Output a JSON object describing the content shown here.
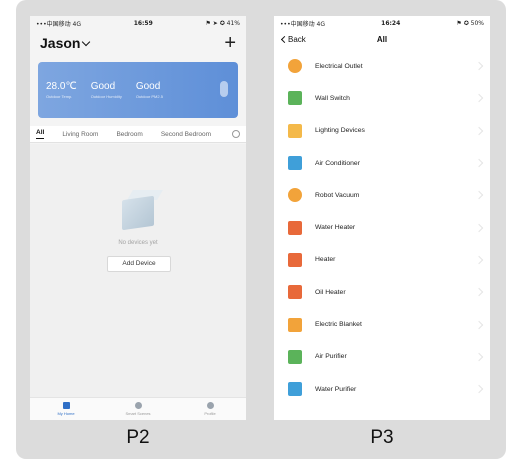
{
  "p2": {
    "status": {
      "carrier": "•••中国移动 4G",
      "time": "16:59",
      "battery": "⚑ ➤ ✪ 41%"
    },
    "header": {
      "home_name": "Jason"
    },
    "weather": {
      "temp": "28.0℃",
      "air": "Good",
      "quality": "Good",
      "temp_sub": "Outdoor Temp.",
      "air_sub": "Outdoor Humidity",
      "quality_sub": "Outdoor PM2.5"
    },
    "tabs": [
      "All",
      "Living Room",
      "Bedroom",
      "Second Bedroom"
    ],
    "empty_text": "No devices yet",
    "add_device_label": "Add Device",
    "tabbar": [
      "My Home",
      "Smart Scenes",
      "Profile"
    ]
  },
  "p3": {
    "status": {
      "carrier": "•••中国移动 4G",
      "time": "16:24",
      "battery": "⚑ ✪ 50%"
    },
    "header": {
      "back_label": "Back",
      "title": "All"
    },
    "devices": [
      {
        "label": "Electrical Outlet",
        "icon": "outlet-icon",
        "color": "#f2a33a"
      },
      {
        "label": "Wall Switch",
        "icon": "switch-icon",
        "color": "#5bb35a"
      },
      {
        "label": "Lighting Devices",
        "icon": "bulb-icon",
        "color": "#f4b94a"
      },
      {
        "label": "Air Conditioner",
        "icon": "ac-icon",
        "color": "#3f9fd9"
      },
      {
        "label": "Robot Vacuum",
        "icon": "vacuum-icon",
        "color": "#f2a33a"
      },
      {
        "label": "Water Heater",
        "icon": "water-heater-icon",
        "color": "#e8693a"
      },
      {
        "label": "Heater",
        "icon": "heater-icon",
        "color": "#e8693a"
      },
      {
        "label": "Oil Heater",
        "icon": "oil-heater-icon",
        "color": "#e8693a"
      },
      {
        "label": "Electric Blanket",
        "icon": "blanket-icon",
        "color": "#f2a33a"
      },
      {
        "label": "Air Purifier",
        "icon": "purifier-icon",
        "color": "#5bb35a"
      },
      {
        "label": "Water Purifier",
        "icon": "water-purifier-icon",
        "color": "#3f9fd9"
      }
    ]
  },
  "captions": {
    "left": "P2",
    "right": "P3"
  }
}
